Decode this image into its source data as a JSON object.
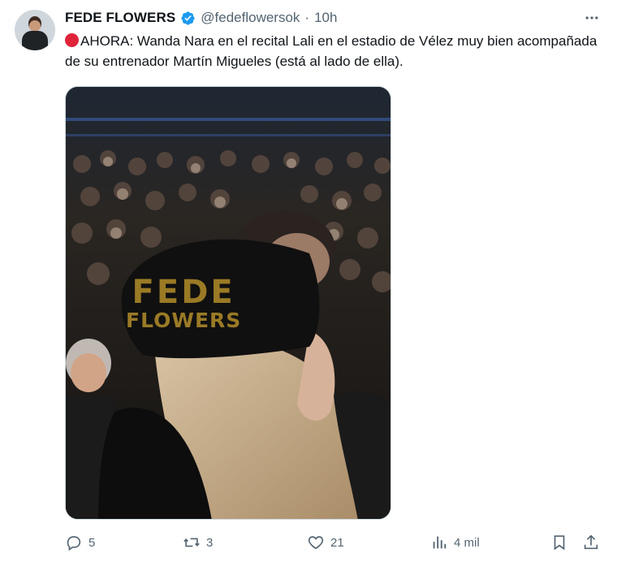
{
  "author": {
    "name": "FEDE FLOWERS",
    "handle": "@fedeflowersok",
    "separator": "·",
    "time": "10h",
    "verified": true
  },
  "tweet": {
    "text_main": "AHORA: Wanda Nara  en el recital Lali en el estadio de Vélez muy bien acompañada de su entrenador Martín Migueles (está al lado de ella).",
    "emoji_icon": "red-circle-icon"
  },
  "media": {
    "watermark_line1": "FEDE",
    "watermark_line2": "FLOWERS"
  },
  "actions": {
    "replies": "5",
    "retweets": "3",
    "likes": "21",
    "views": "4 mil"
  },
  "colors": {
    "accent": "#1d9bf0",
    "muted": "#536471",
    "red_dot": "#e0243a",
    "watermark": "#9a7a25"
  }
}
